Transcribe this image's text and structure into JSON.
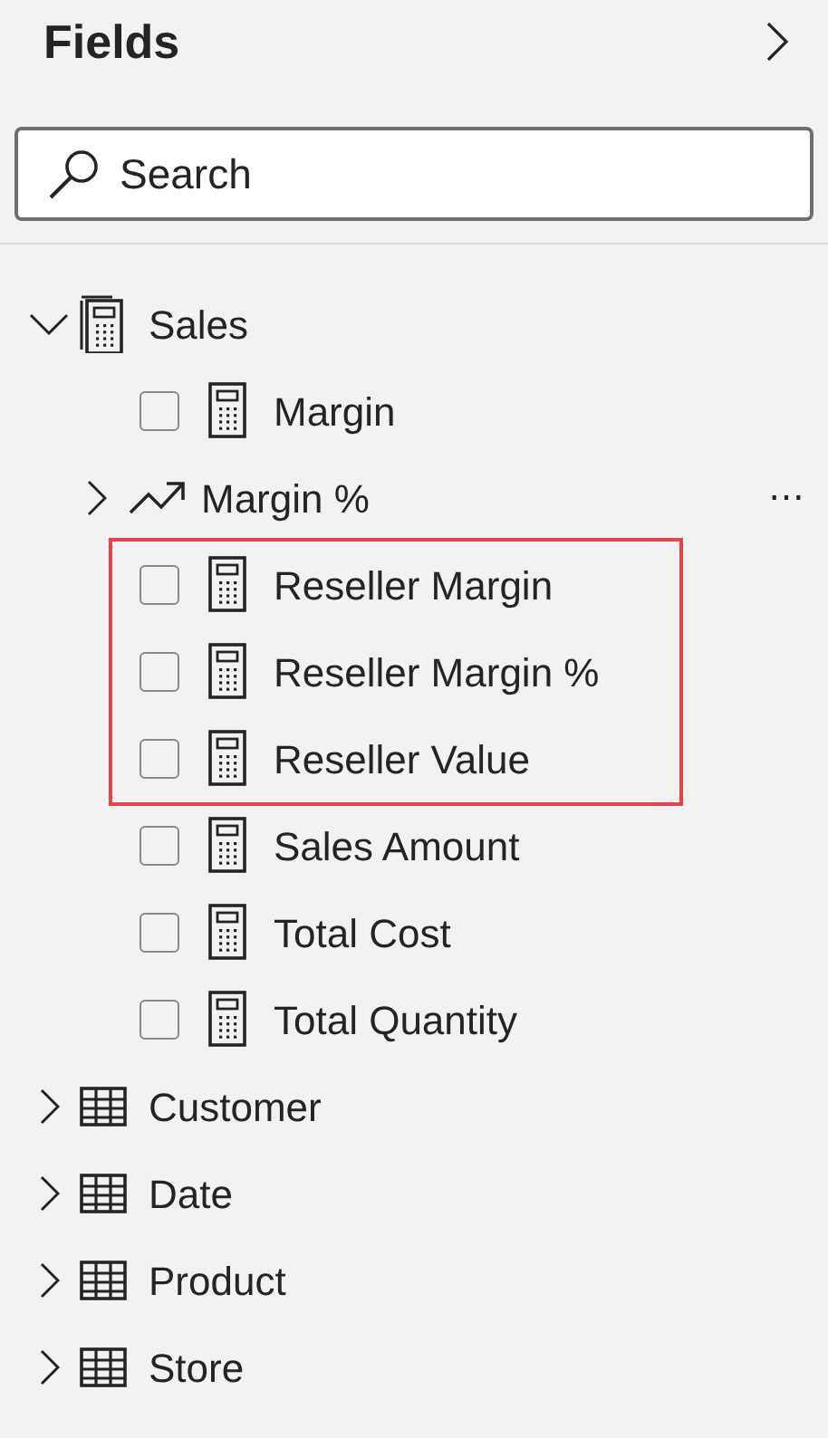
{
  "panel": {
    "title": "Fields"
  },
  "search": {
    "placeholder": "Search"
  },
  "tables": [
    {
      "name": "Sales",
      "kind": "measure_table",
      "expanded": true,
      "children": [
        {
          "name": "Margin",
          "kind": "measure",
          "checked": false,
          "highlighted": false
        },
        {
          "name": "Margin %",
          "kind": "kpi",
          "expanded": false,
          "more": "⋯"
        },
        {
          "name": "Reseller Margin",
          "kind": "measure",
          "checked": false,
          "highlighted": true
        },
        {
          "name": "Reseller Margin %",
          "kind": "measure",
          "checked": false,
          "highlighted": true
        },
        {
          "name": "Reseller Value",
          "kind": "measure",
          "checked": false,
          "highlighted": true
        },
        {
          "name": "Sales Amount",
          "kind": "measure",
          "checked": false,
          "highlighted": false
        },
        {
          "name": "Total Cost",
          "kind": "measure",
          "checked": false,
          "highlighted": false
        },
        {
          "name": "Total Quantity",
          "kind": "measure",
          "checked": false,
          "highlighted": false
        }
      ]
    },
    {
      "name": "Customer",
      "kind": "table",
      "expanded": false
    },
    {
      "name": "Date",
      "kind": "table",
      "expanded": false
    },
    {
      "name": "Product",
      "kind": "table",
      "expanded": false
    },
    {
      "name": "Store",
      "kind": "table",
      "expanded": false
    }
  ]
}
